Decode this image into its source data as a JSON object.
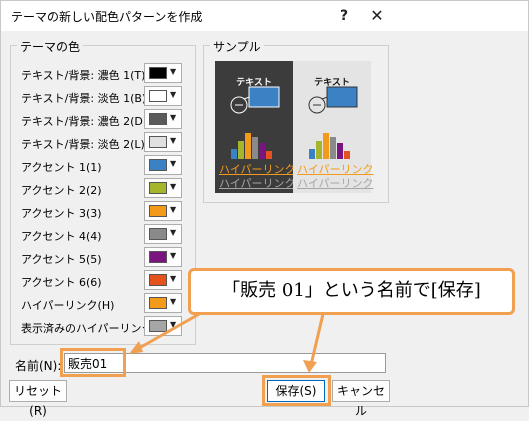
{
  "dialog": {
    "title": "テーマの新しい配色パターンを作成",
    "help_icon": "?",
    "close_icon": "✕"
  },
  "theme_colors": {
    "label": "テーマの色",
    "items": [
      {
        "label": "テキスト/背景: 濃色 1(T)",
        "color": "#000000"
      },
      {
        "label": "テキスト/背景: 淡色 1(B)",
        "color": "#ffffff"
      },
      {
        "label": "テキスト/背景: 濃色 2(D)",
        "color": "#44546a"
      },
      {
        "label": "テキスト/背景: 淡色 2(L)",
        "color": "#e7e6e6"
      },
      {
        "label": "アクセント 1(1)",
        "color": "#3b82c4"
      },
      {
        "label": "アクセント 2(2)",
        "color": "#a5b52c"
      },
      {
        "label": "アクセント 3(3)",
        "color": "#f39a1a"
      },
      {
        "label": "アクセント 4(4)",
        "color": "#8a8a8a"
      },
      {
        "label": "アクセント 5(5)",
        "color": "#7a1580"
      },
      {
        "label": "アクセント 6(6)",
        "color": "#e5521e"
      },
      {
        "label": "ハイパーリンク(H)",
        "color": "#f39a1a"
      },
      {
        "label": "表示済みのハイパーリンク(F)",
        "color": "#a6a6a6"
      }
    ]
  },
  "sample": {
    "label": "サンプル",
    "text": "テキスト",
    "hyperlink": "ハイパーリンク",
    "followed_hyperlink": "ハイパーリンク"
  },
  "name": {
    "label": "名前(N):",
    "value": "販売01"
  },
  "buttons": {
    "reset": "リセット(R)",
    "save": "保存(S)",
    "cancel": "キャンセル"
  },
  "annotation": {
    "text": "「販売 01」という名前で[保存]",
    "color": "#f0a050"
  }
}
